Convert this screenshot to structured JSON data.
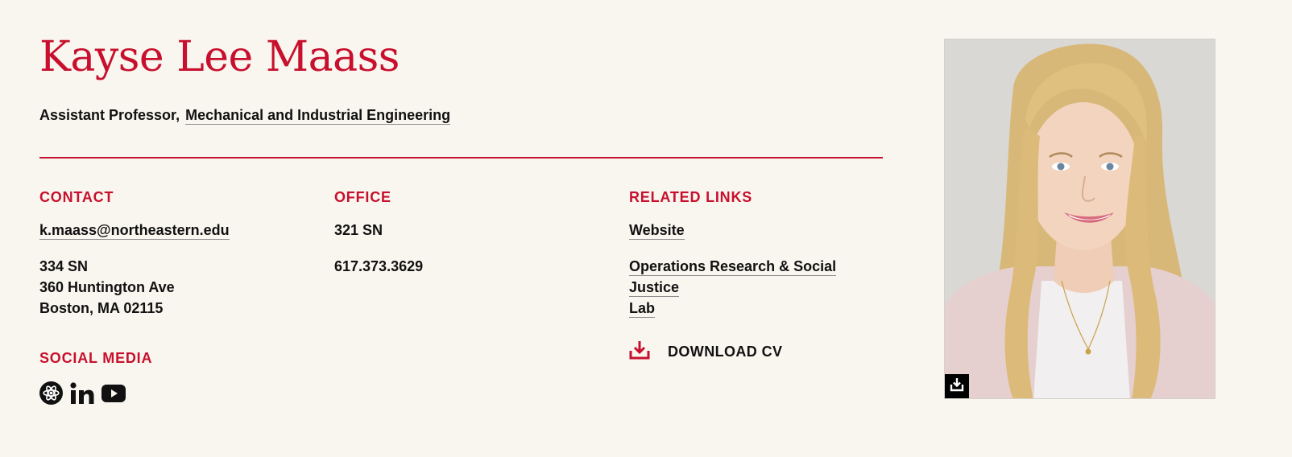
{
  "profile": {
    "name": "Kayse Lee Maass",
    "role": "Assistant Professor,",
    "department": "Mechanical and Industrial Engineering"
  },
  "contact": {
    "heading": "CONTACT",
    "email": "k.maass@northeastern.edu",
    "address": [
      "334 SN",
      "360 Huntington Ave",
      "Boston, MA 02115"
    ]
  },
  "office": {
    "heading": "OFFICE",
    "room": "321 SN",
    "phone": "617.373.3629"
  },
  "related_links": {
    "heading": "RELATED LINKS",
    "links": [
      "Website",
      "Operations Research & Social Justice",
      "Lab"
    ],
    "download_label": "DOWNLOAD CV"
  },
  "social": {
    "heading": "SOCIAL MEDIA",
    "icons": [
      "science-network-icon",
      "linkedin-icon",
      "youtube-icon"
    ]
  },
  "colors": {
    "accent": "#c8102e",
    "background": "#f9f6ef",
    "text": "#111111"
  }
}
